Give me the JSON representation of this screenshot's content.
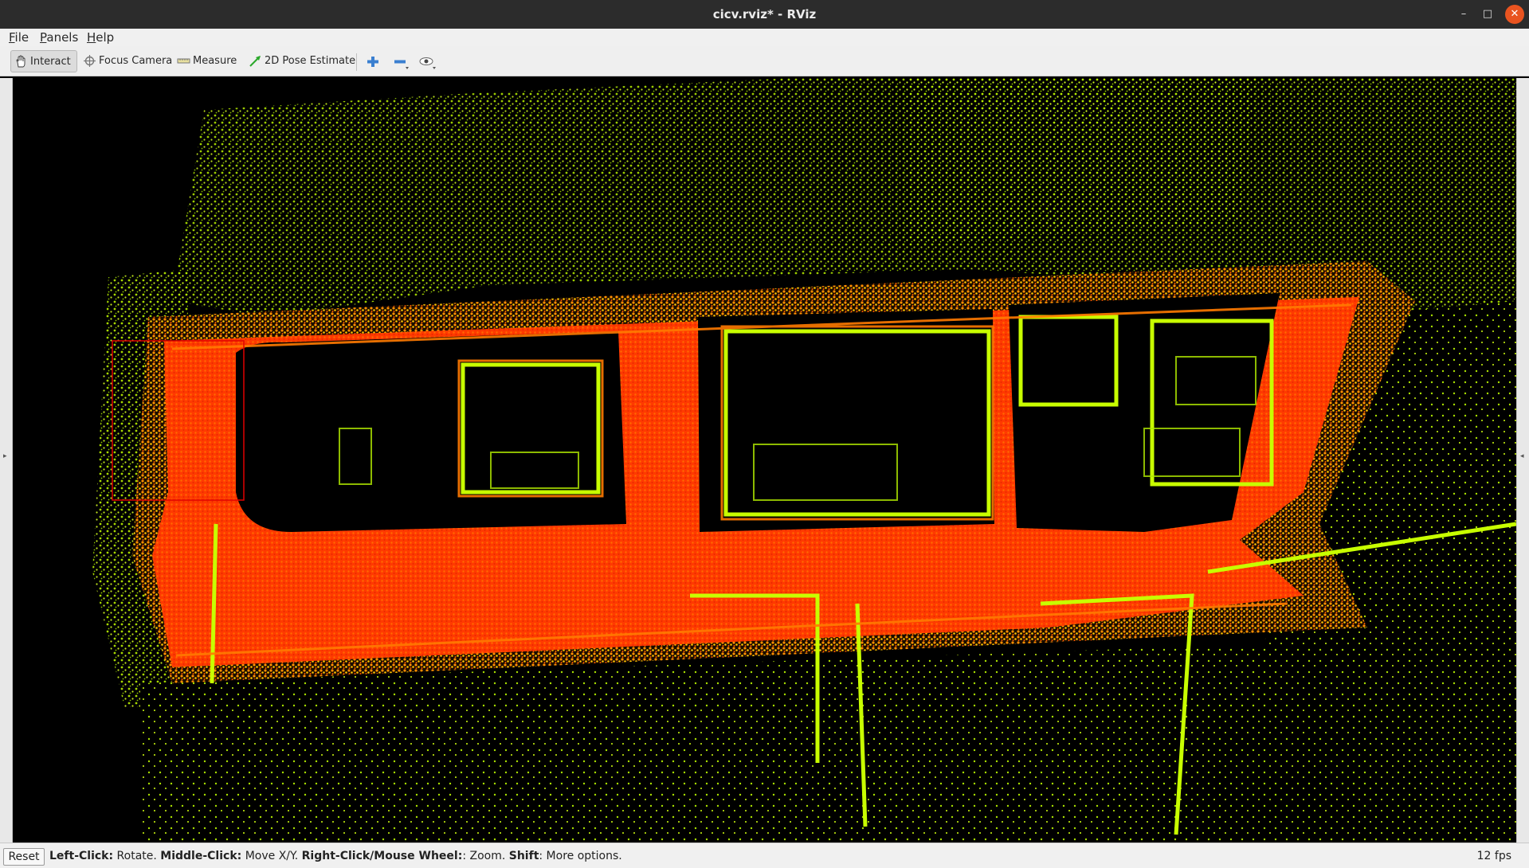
{
  "window": {
    "title": "cicv.rviz* - RViz",
    "controls": {
      "minimize": "–",
      "maximize": "□",
      "close": "✕"
    }
  },
  "menubar": {
    "items": [
      {
        "mnemonic": "F",
        "rest": "ile"
      },
      {
        "mnemonic": "P",
        "rest": "anels"
      },
      {
        "mnemonic": "H",
        "rest": "elp"
      }
    ]
  },
  "toolbar": {
    "tools": [
      {
        "label": "Interact",
        "icon": "hand-icon",
        "active": true
      },
      {
        "label": "Focus Camera",
        "icon": "crosshair-icon"
      },
      {
        "label": "Measure",
        "icon": "ruler-icon"
      },
      {
        "label": "2D Pose Estimate",
        "icon": "arrow-icon"
      }
    ],
    "extra_icons": [
      "plus-icon",
      "minus-icon",
      "eye-icon"
    ]
  },
  "viewport": {
    "content": "point-cloud-map",
    "background": "#000000",
    "colors": {
      "near": "#ff3a00",
      "mid": "#ff8a00",
      "far": "#c8ff00"
    }
  },
  "statusbar": {
    "reset_label": "Reset",
    "help": [
      {
        "key": "Left-Click:",
        "desc": " Rotate. "
      },
      {
        "key": "Middle-Click:",
        "desc": " Move X/Y. "
      },
      {
        "key": "Right-Click/Mouse Wheel:",
        "desc": ": Zoom. "
      },
      {
        "key": "Shift",
        "desc": ": More options."
      }
    ],
    "fps": "12 fps"
  }
}
